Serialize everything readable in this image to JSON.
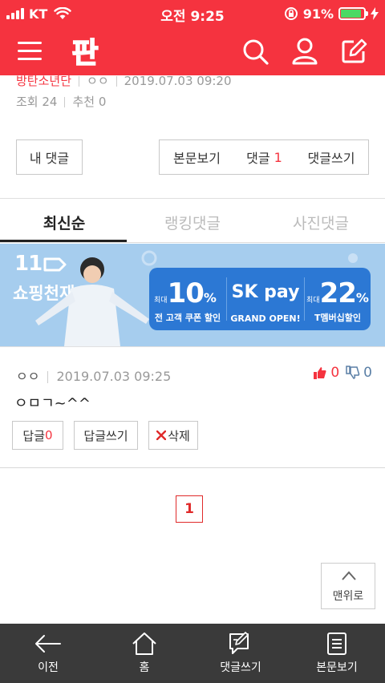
{
  "status_bar": {
    "carrier": "KT",
    "time": "오전 9:25",
    "battery_percent": "91%",
    "battery_level": 0.91,
    "colors": {
      "bar": "#f5333f",
      "battery": "#4cd964"
    }
  },
  "header": {
    "logo_text": "판",
    "icons": [
      "menu-icon",
      "search-icon",
      "user-icon",
      "edit-icon"
    ]
  },
  "article_meta": {
    "author": "방탄소년단",
    "nickname": "ㅇㅇ",
    "datetime": "2019.07.03 09:20",
    "views_label": "조회",
    "views": "24",
    "recommend_label": "추천",
    "recommend": "0"
  },
  "comment_actions": {
    "my_comments": "내 댓글",
    "view_post": "본문보기",
    "comments_label": "댓글",
    "comments_count": "1",
    "write_comment": "댓글쓰기"
  },
  "tabs": [
    {
      "label": "최신순",
      "active": true
    },
    {
      "label": "랭킹댓글",
      "active": false
    },
    {
      "label": "사진댓글",
      "active": false
    }
  ],
  "banner": {
    "brand": "11",
    "title": "쇼핑천재",
    "offer1_prefix": "최대",
    "offer1_value": "10",
    "offer1_unit": "%",
    "offer1_caption": "전 고객 쿠폰 할인",
    "middle_logo": "SK pay",
    "middle_caption": "GRAND OPEN!",
    "offer2_prefix": "최대",
    "offer2_value": "22",
    "offer2_unit": "%",
    "offer2_caption": "T멤버십할인",
    "colors": {
      "background": "#a6cdee",
      "promo": "#2c78d4"
    }
  },
  "comment": {
    "nickname": "ㅇㅇ",
    "datetime": "2019.07.03 09:25",
    "likes": "0",
    "dislikes": "0",
    "body": "ㅇㅁㄱ~^^",
    "reply_label": "답글",
    "reply_count": "0",
    "write_reply": "답글쓰기",
    "delete": "삭제"
  },
  "pagination": {
    "current": "1"
  },
  "to_top": {
    "label": "맨위로"
  },
  "bottom_bar": [
    {
      "label": "이전",
      "icon": "back-arrow-icon"
    },
    {
      "label": "홈",
      "icon": "home-icon"
    },
    {
      "label": "댓글쓰기",
      "icon": "write-comment-icon"
    },
    {
      "label": "본문보기",
      "icon": "document-icon"
    }
  ]
}
